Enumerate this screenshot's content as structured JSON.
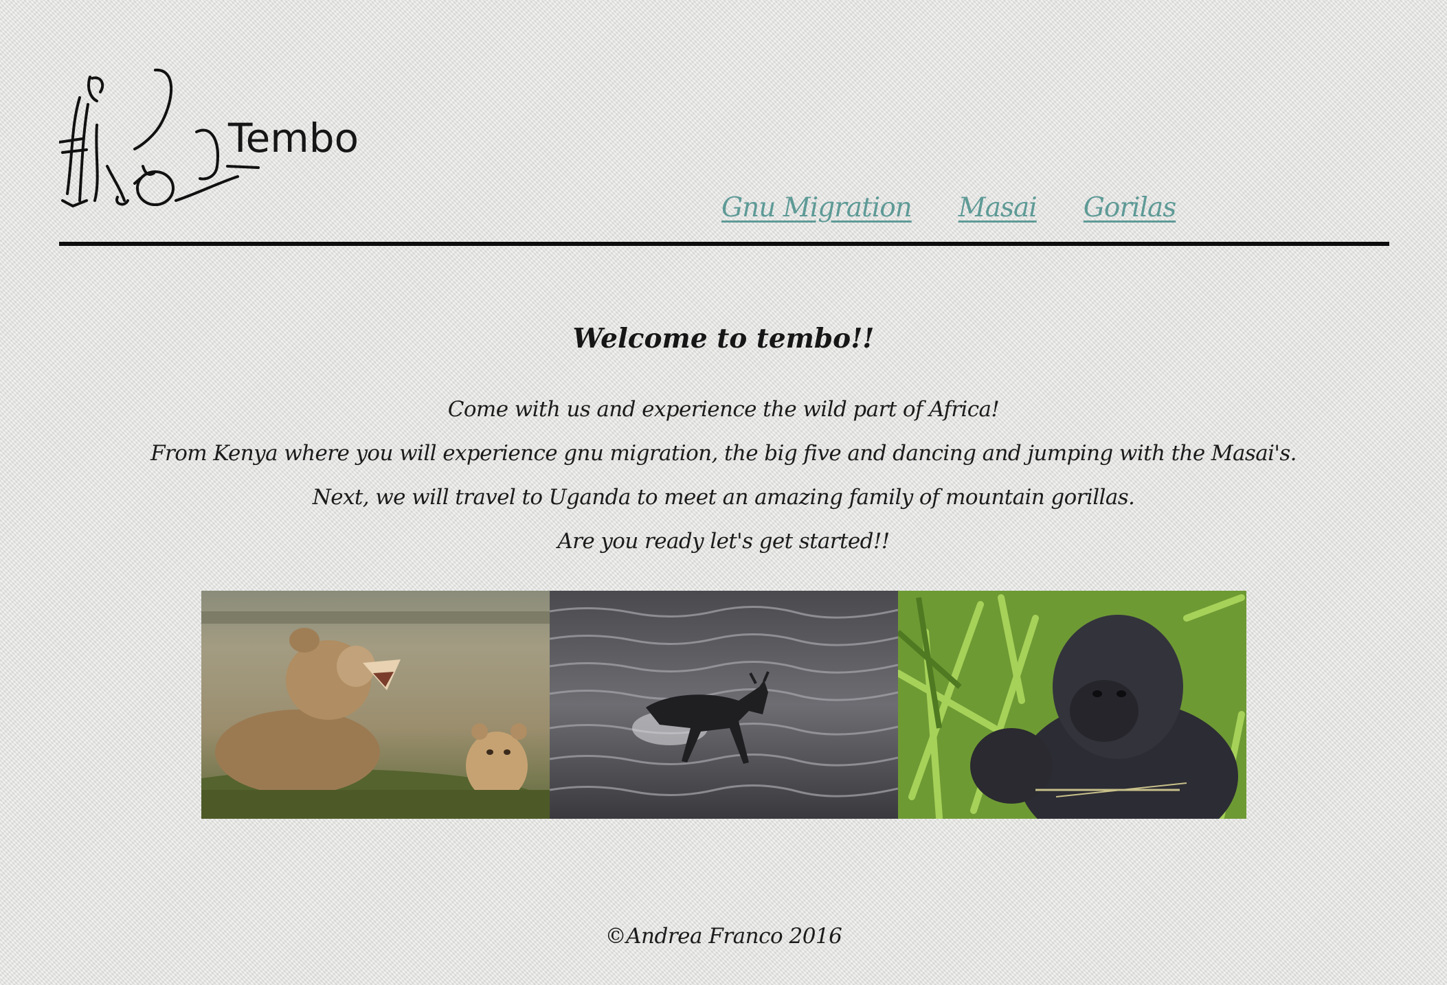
{
  "header": {
    "logo_text": "Tembo",
    "nav": [
      {
        "label": "Gnu Migration"
      },
      {
        "label": "Masai"
      },
      {
        "label": "Gorilas"
      }
    ]
  },
  "main": {
    "welcome": "Welcome to tembo!!",
    "intro": [
      "Come with us and experience the wild part of Africa!",
      "From Kenya where you will experience gnu migration, the big five and dancing and jumping with the Masai's.",
      "Next, we will travel to Uganda to meet an amazing family of mountain gorillas.",
      "Are you ready let's get started!!"
    ]
  },
  "footer": {
    "copyright": "©Andrea Franco 2016"
  },
  "colors": {
    "nav_link": "#5e9a96",
    "rule": "#0d0d0d",
    "background": "#e4e4e2"
  }
}
